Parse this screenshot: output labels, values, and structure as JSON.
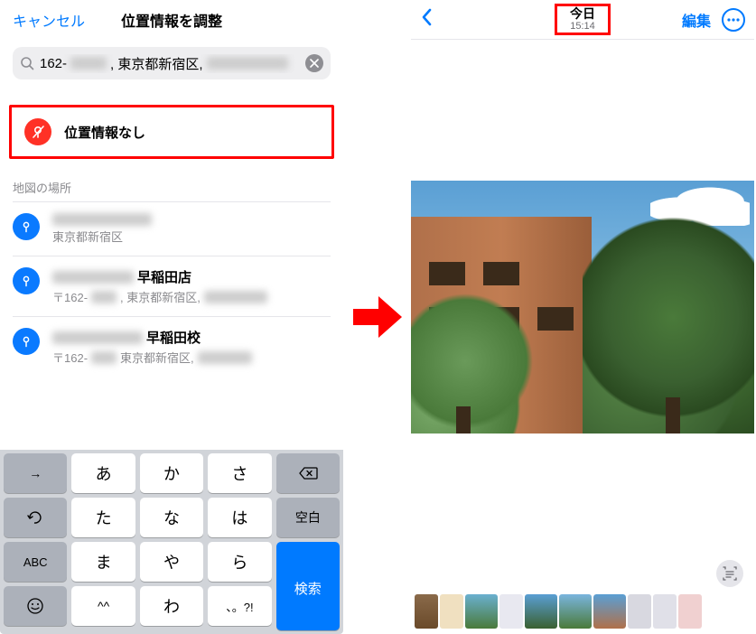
{
  "left": {
    "cancel_label": "キャンセル",
    "title": "位置情報を調整",
    "search_prefix": "162-",
    "search_mid": ", 東京都新宿区, ",
    "no_location_label": "位置情報なし",
    "section_header": "地図の場所",
    "places": [
      {
        "title_suffix": "",
        "sub_text": "東京都新宿区"
      },
      {
        "title_suffix": "早稲田店",
        "sub_prefix": "〒162-",
        "sub_mid": ", 東京都新宿区, "
      },
      {
        "title_suffix": "早稲田校",
        "sub_prefix": "〒162-",
        "sub_mid": "東京都新宿区, "
      }
    ],
    "keys": {
      "row1": [
        "→",
        "あ",
        "か",
        "さ"
      ],
      "row2": [
        "↺",
        "た",
        "な",
        "は"
      ],
      "row3": [
        "ABC",
        "ま",
        "や",
        "ら"
      ],
      "row4": [
        "☺",
        "^^",
        "わ",
        "、。?!"
      ],
      "backspace": "⌫",
      "space": "空白",
      "search": "検索"
    }
  },
  "right": {
    "date": "今日",
    "time": "15:14",
    "edit_label": "編集"
  }
}
